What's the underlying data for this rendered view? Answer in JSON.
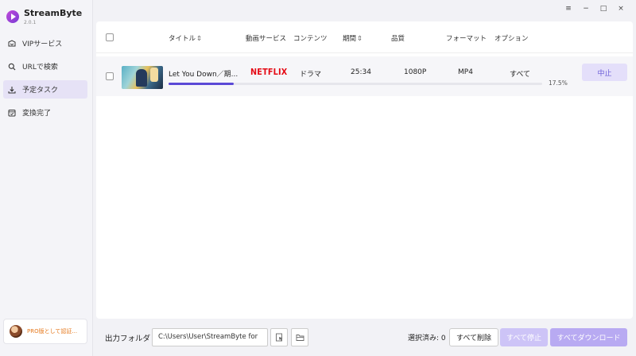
{
  "app": {
    "name": "StreamByte",
    "version": "2.0.1"
  },
  "window_controls": {
    "menu": "≡",
    "minimize": "−",
    "maximize": "□",
    "close": "×"
  },
  "sidebar": {
    "items": [
      {
        "label": "VIPサービス",
        "icon": "vip-icon",
        "active": false
      },
      {
        "label": "URLで検索",
        "icon": "search-icon",
        "active": false
      },
      {
        "label": "予定タスク",
        "icon": "download-icon",
        "active": true
      },
      {
        "label": "変換完了",
        "icon": "completed-icon",
        "active": false
      }
    ],
    "pro_label": "PRO版として認証..."
  },
  "table": {
    "headers": {
      "title": "タイトル",
      "service": "動画サービス",
      "content": "コンテンツ",
      "duration": "期間",
      "quality": "品質",
      "format": "フォーマット",
      "options": "オプション"
    },
    "sort_glyph": "⇕",
    "rows": [
      {
        "title": "Let You Down／期...",
        "service": "NETFLIX",
        "content": "ドラマ",
        "duration": "25:34",
        "quality": "1080P",
        "format": "MP4",
        "option": "すべて",
        "progress": 17.5,
        "progress_label": "17.5%",
        "action": "中止"
      }
    ]
  },
  "footer": {
    "output_label": "出力フォルダ",
    "output_path": "C:\\Users\\User\\StreamByte for",
    "selected_label": "選択済み: 0",
    "delete_all": "すべて削除",
    "stop_all": "すべて停止",
    "download_all": "すべてダウンロード"
  },
  "colors": {
    "accent": "#5b49d6",
    "netflix": "#e50914",
    "pro_text": "#e67a1f",
    "active_nav": "#e6e2f6"
  }
}
